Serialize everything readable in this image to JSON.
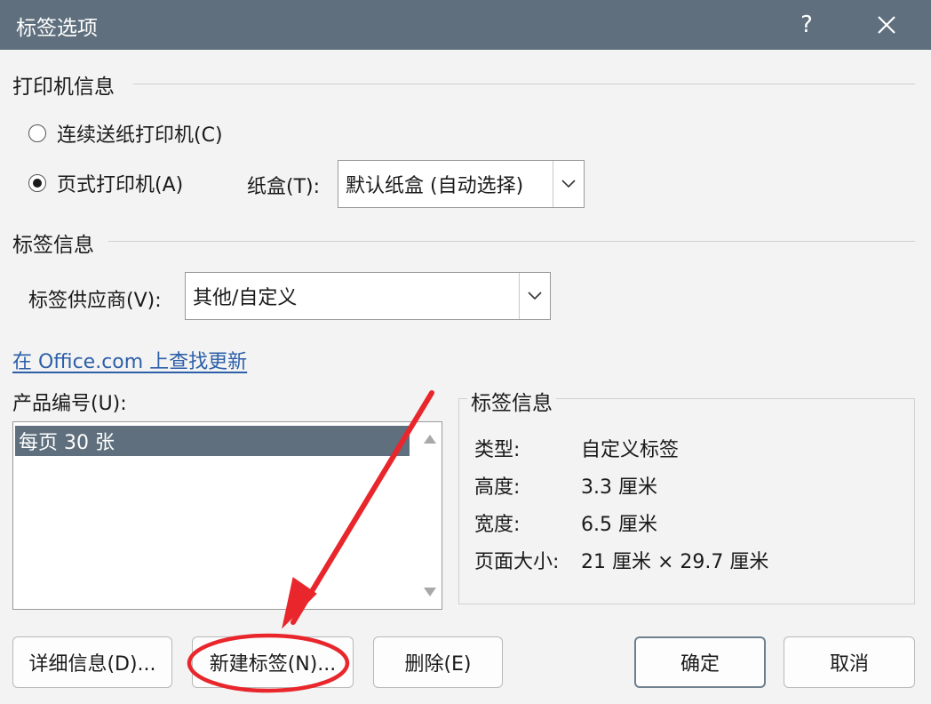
{
  "window": {
    "title": "标签选项",
    "help_glyph": "?",
    "close_glyph": "✕"
  },
  "printer_info": {
    "heading": "打印机信息",
    "continuous_label": "连续送纸打印机(C)",
    "page_label": "页式打印机(A)",
    "tray_label": "纸盒(T):",
    "tray_value": "默认纸盒 (自动选择)",
    "selected": "page"
  },
  "label_info_section": {
    "heading": "标签信息",
    "vendor_label": "标签供应商(V):",
    "vendor_value": "其他/自定义",
    "update_link": "在 Office.com 上查找更新"
  },
  "product": {
    "label": "产品编号(U):",
    "items": [
      "每页 30 张"
    ],
    "selected_index": 0
  },
  "details": {
    "heading": "标签信息",
    "rows": [
      {
        "key": "类型:",
        "value": "自定义标签"
      },
      {
        "key": "高度:",
        "value": "3.3 厘米"
      },
      {
        "key": "宽度:",
        "value": "6.5 厘米"
      },
      {
        "key": "页面大小:",
        "value": "21 厘米 × 29.7 厘米"
      }
    ]
  },
  "buttons": {
    "details": "详细信息(D)...",
    "new_label": "新建标签(N)...",
    "delete": "删除(E)",
    "ok": "确定",
    "cancel": "取消"
  },
  "annotation": {
    "color": "#e8262b"
  }
}
